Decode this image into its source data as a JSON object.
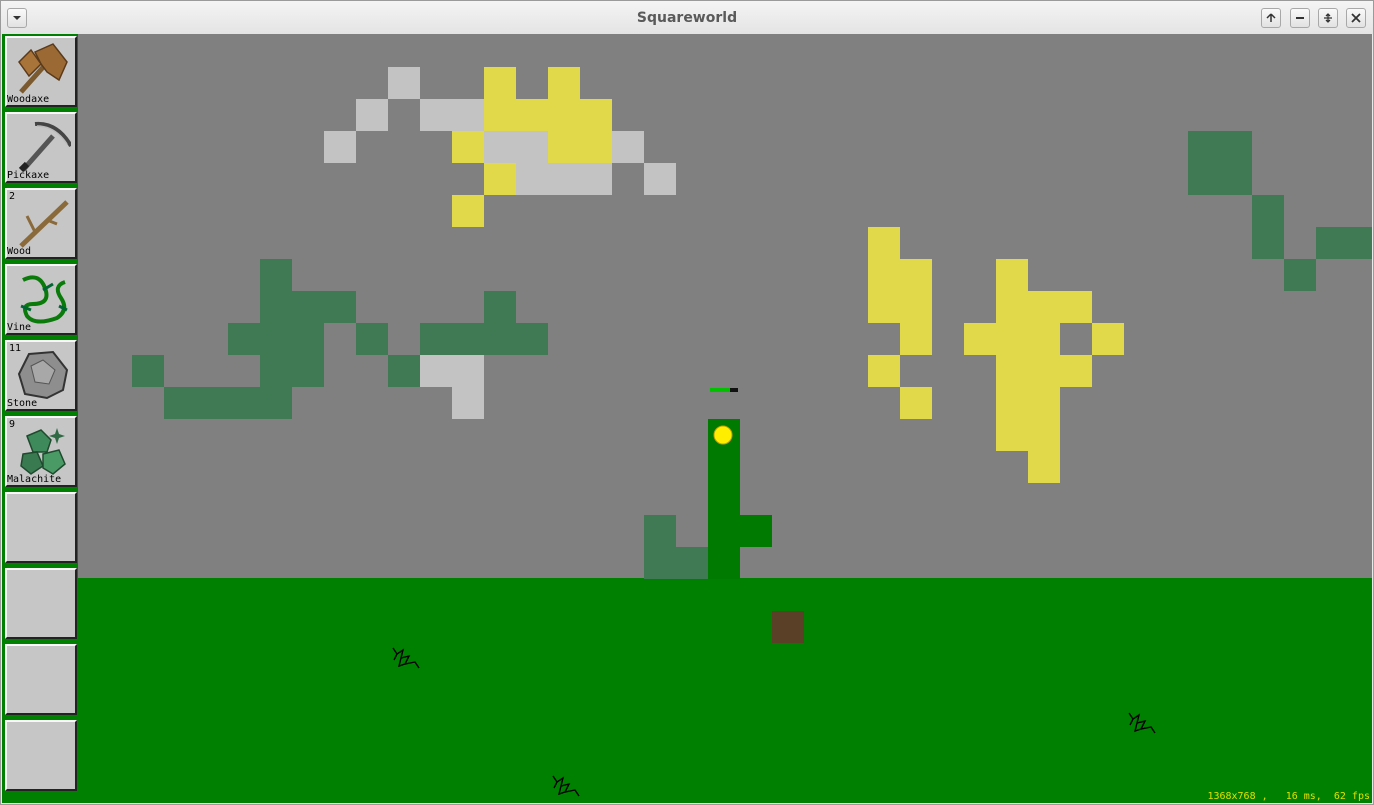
{
  "window": {
    "title": "Squareworld"
  },
  "titlebar_buttons": [
    "menu-dropdown",
    "keep-above",
    "minimize",
    "maximize",
    "close"
  ],
  "inventory": {
    "slots": [
      {
        "label": "Woodaxe",
        "count": "",
        "icon": "woodaxe-icon"
      },
      {
        "label": "Pickaxe",
        "count": "",
        "icon": "pickaxe-icon"
      },
      {
        "label": "Wood",
        "count": "2",
        "icon": "wood-icon"
      },
      {
        "label": "Vine",
        "count": "",
        "icon": "vine-icon"
      },
      {
        "label": "Stone",
        "count": "11",
        "icon": "stone-icon"
      },
      {
        "label": "Malachite",
        "count": "9",
        "icon": "malachite-icon"
      },
      {
        "label": "",
        "count": "",
        "icon": ""
      },
      {
        "label": "",
        "count": "",
        "icon": ""
      },
      {
        "label": "",
        "count": "",
        "icon": ""
      },
      {
        "label": "",
        "count": "",
        "icon": ""
      }
    ]
  },
  "player": {
    "health_fraction": 0.7
  },
  "status": {
    "text": "1368x768 ,   16 ms,  62 fps"
  },
  "colors": {
    "sky": "#808080",
    "grass": "#008000",
    "vine": "#3f7a55",
    "stone": "#c3c3c3",
    "sulfur": "#e2d94a",
    "tree": "#007a00",
    "dirt": "#5a4026",
    "status_text": "#e0e000"
  }
}
